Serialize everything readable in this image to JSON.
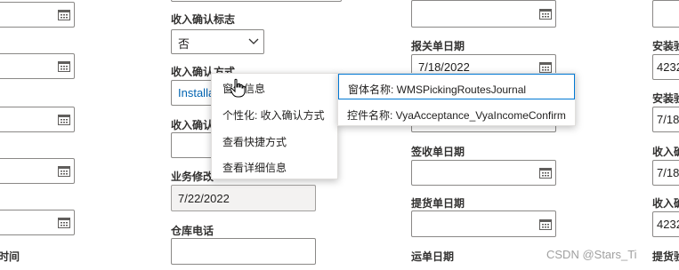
{
  "col2": {
    "income_flag_label": "收入确认标志",
    "income_flag_value": "否",
    "income_method_label": "收入确认方式",
    "income_method_value": "Installa",
    "income_date_label": "收入确认",
    "biz_modify_label": "业务修改",
    "biz_modify_value": "7/22/2022",
    "warehouse_phone_label": "仓库电话"
  },
  "col3": {
    "customs_date_label": "报关单日期",
    "customs_date_value": "7/18/2022",
    "sign_date_label": "签收单日期",
    "pickup_date_label": "提货单日期",
    "waybill_date_label": "运单日期"
  },
  "col4": {
    "install1_label": "安装验",
    "install1_value": "4232",
    "install2_label": "安装验",
    "install2_value": "7/18",
    "income1_label": "收入确",
    "income1_value": "7/18",
    "income2_label": "收入确",
    "income2_value": "4232",
    "pickup_label": "提货验"
  },
  "col1": {
    "time_label": "时间"
  },
  "context_menu": {
    "items": [
      "窗体信息",
      "个性化: 收入确认方式",
      "查看快捷方式",
      "查看详细信息"
    ]
  },
  "submenu": {
    "form_name": "窗体名称: WMSPickingRoutesJournal",
    "control_name": "控件名称: VyaAcceptance_VyaIncomeConfirm"
  },
  "watermark": "CSDN @Stars_Ti"
}
